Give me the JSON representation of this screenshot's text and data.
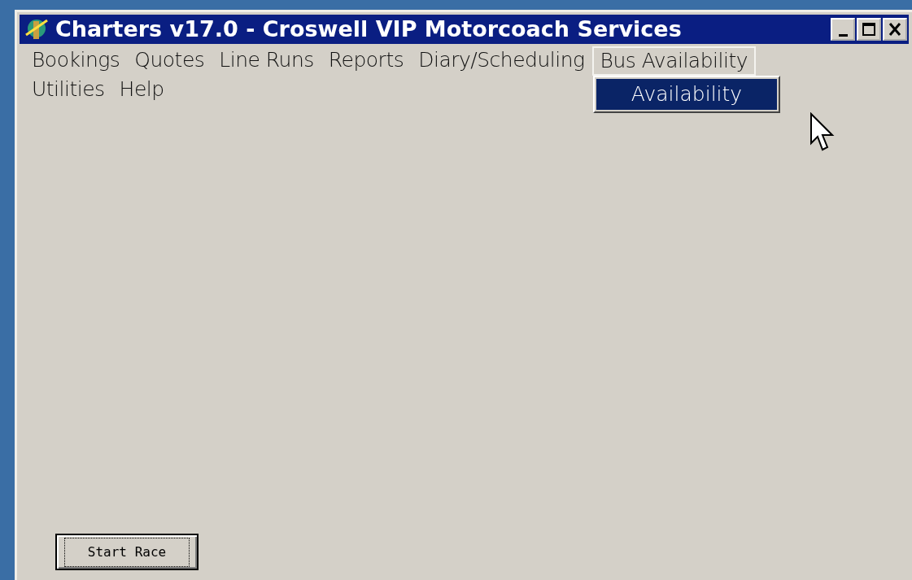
{
  "window": {
    "title": "Charters v17.0 - Croswell VIP Motorcoach Services"
  },
  "menu": [
    {
      "label": "Bookings",
      "selected": false
    },
    {
      "label": "Quotes",
      "selected": false
    },
    {
      "label": "Line Runs",
      "selected": false
    },
    {
      "label": "Reports",
      "selected": false
    },
    {
      "label": "Diary/Scheduling",
      "selected": false
    },
    {
      "label": "Bus Availability",
      "selected": true
    },
    {
      "label": "Utilities",
      "selected": false
    },
    {
      "label": "Help",
      "selected": false
    }
  ],
  "dropdown": [
    {
      "label": "Availability",
      "selected": true
    }
  ],
  "buttons": [
    "Start Race"
  ]
}
